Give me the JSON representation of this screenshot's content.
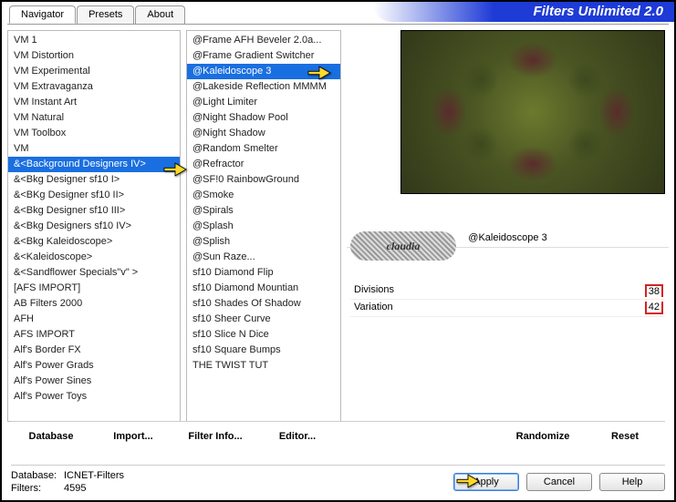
{
  "app_title": "Filters Unlimited 2.0",
  "tabs": [
    "Navigator",
    "Presets",
    "About"
  ],
  "active_tab": 0,
  "categories": [
    "VM 1",
    "VM Distortion",
    "VM Experimental",
    "VM Extravaganza",
    "VM Instant Art",
    "VM Natural",
    "VM Toolbox",
    "VM",
    "&<Background Designers IV>",
    "&<Bkg Designer sf10 I>",
    "&<BKg Designer sf10 II>",
    "&<Bkg Designer sf10 III>",
    "&<Bkg Designers sf10 IV>",
    "&<Bkg Kaleidoscope>",
    "&<Kaleidoscope>",
    "&<Sandflower Specials\"v\" >",
    "[AFS IMPORT]",
    "AB Filters 2000",
    "AFH",
    "AFS IMPORT",
    "Alf's Border FX",
    "Alf's Power Grads",
    "Alf's Power Sines",
    "Alf's Power Toys"
  ],
  "selected_category_index": 8,
  "filters": [
    "@Frame AFH Beveler 2.0a...",
    "@Frame Gradient Switcher",
    "@Kaleidoscope 3",
    "@Lakeside Reflection MMMM",
    "@Light Limiter",
    "@Night Shadow Pool",
    "@Night Shadow",
    "@Random Smelter",
    "@Refractor",
    "@SF!0 RainbowGround",
    "@Smoke",
    "@Spirals",
    "@Splash",
    "@Splish",
    "@Sun Raze...",
    "sf10 Diamond Flip",
    "sf10 Diamond Mountian",
    "sf10 Shades Of Shadow",
    "sf10 Sheer Curve",
    "sf10 Slice N Dice",
    "sf10 Square Bumps",
    "THE TWIST TUT"
  ],
  "selected_filter_index": 2,
  "current_filter_label": "@Kaleidoscope 3",
  "params": [
    {
      "name": "Divisions",
      "value": "38"
    },
    {
      "name": "Variation",
      "value": "42"
    }
  ],
  "mid_buttons": {
    "database": "Database",
    "import": "Import...",
    "filter_info": "Filter Info...",
    "editor": "Editor...",
    "randomize": "Randomize",
    "reset": "Reset"
  },
  "status": {
    "db_label": "Database:",
    "db_value": "ICNET-Filters",
    "filters_label": "Filters:",
    "filters_value": "4595"
  },
  "bottom_buttons": {
    "apply": "Apply",
    "cancel": "Cancel",
    "help": "Help"
  },
  "watermark": "claudia"
}
